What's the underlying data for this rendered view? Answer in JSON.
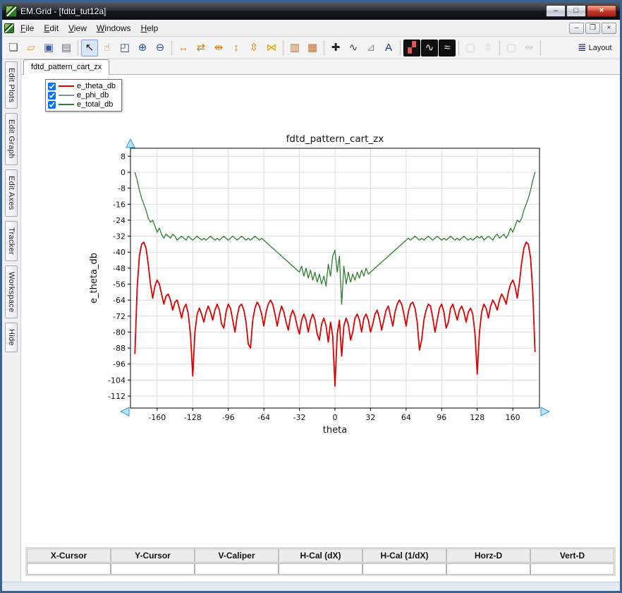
{
  "window": {
    "title": "EM.Grid - [fdtd_tut12a]"
  },
  "titlebar_buttons": [
    {
      "name": "minimize",
      "glyph": "–"
    },
    {
      "name": "maximize",
      "glyph": "□"
    },
    {
      "name": "close",
      "glyph": "×"
    }
  ],
  "menu": {
    "items": [
      "File",
      "Edit",
      "View",
      "Windows",
      "Help"
    ]
  },
  "mdi_buttons": [
    {
      "name": "child-minimize",
      "glyph": "–"
    },
    {
      "name": "child-restore",
      "glyph": "❐"
    },
    {
      "name": "child-close",
      "glyph": "×"
    }
  ],
  "toolbar": {
    "buttons": [
      {
        "name": "new-file",
        "glyph": "❏",
        "color": "#555555"
      },
      {
        "name": "open-folder",
        "glyph": "▱",
        "color": "#d99a2b"
      },
      {
        "name": "save",
        "glyph": "▣",
        "color": "#3a57a8"
      },
      {
        "name": "print",
        "glyph": "▤",
        "color": "#666677"
      },
      {
        "name": "select-cursor",
        "glyph": "↖",
        "color": "#111111",
        "pressed": true,
        "sep": true
      },
      {
        "name": "pan-hand",
        "glyph": "☝",
        "color": "#b9854a"
      },
      {
        "name": "zoom-window",
        "glyph": "◰",
        "color": "#25417a"
      },
      {
        "name": "zoom-in",
        "glyph": "⊕",
        "color": "#1f4fae"
      },
      {
        "name": "zoom-out",
        "glyph": "⊖",
        "color": "#1f4fae"
      },
      {
        "name": "expand-horizontal",
        "glyph": "↔",
        "color": "#e07c00",
        "sep": true
      },
      {
        "name": "shrink-horizontal",
        "glyph": "⇄",
        "color": "#e07c00"
      },
      {
        "name": "full-extent-horizontal",
        "glyph": "⇹",
        "color": "#e07c00"
      },
      {
        "name": "expand-vertical",
        "glyph": "↕",
        "color": "#e07c00"
      },
      {
        "name": "full-extent-vertical",
        "glyph": "⇳",
        "color": "#e07c00"
      },
      {
        "name": "autoscale",
        "glyph": "⋈",
        "color": "#e0a400"
      },
      {
        "name": "data-columns",
        "glyph": "▥",
        "color": "#c26a2a",
        "sep": true
      },
      {
        "name": "data-table",
        "glyph": "▦",
        "color": "#c26a2a"
      },
      {
        "name": "crosshair",
        "glyph": "✚",
        "color": "#222222",
        "sep": true
      },
      {
        "name": "curve-marker",
        "glyph": "∿",
        "color": "#333355"
      },
      {
        "name": "caliper",
        "glyph": "⊿",
        "color": "#8a8a8a"
      },
      {
        "name": "text-annotation",
        "glyph": "A",
        "color": "#1a2e8c"
      },
      {
        "name": "image-style",
        "glyph": "▞",
        "color": "#e05555",
        "dark": true,
        "sep": true
      },
      {
        "name": "waveform-style",
        "glyph": "∿",
        "color": "#f0f0f0",
        "dark": true
      },
      {
        "name": "multi-waveform-style",
        "glyph": "≈",
        "color": "#f0f0f0",
        "dark": true
      },
      {
        "name": "sync-y-toggle",
        "glyph": "▢",
        "color": "#999999",
        "disabled": true,
        "sep": true
      },
      {
        "name": "fit-y",
        "glyph": "⇳",
        "color": "#999999",
        "disabled": true
      },
      {
        "name": "sync-x-toggle",
        "glyph": "▢",
        "color": "#999999",
        "disabled": true,
        "sep": true
      },
      {
        "name": "fit-x",
        "glyph": "⇹",
        "color": "#999999",
        "disabled": true
      },
      {
        "name": "layout",
        "glyph": "≣",
        "color": "#1a2e8c",
        "label": "Layout",
        "sep": true
      }
    ]
  },
  "sidebar": {
    "tabs": [
      "Edit Plots",
      "Edit Graph",
      "Edit Axes",
      "Tracker",
      "Workspace",
      "Hide"
    ]
  },
  "plot_tab": {
    "label": "fdtd_pattern_cart_zx"
  },
  "legend": {
    "items": [
      {
        "label": "e_theta_db",
        "color": "#dd0000",
        "checked": true
      },
      {
        "label": "e_phi_db",
        "color": "#8585c2",
        "checked": true
      },
      {
        "label": "e_total_db",
        "color": "#2e7d32",
        "checked": true
      }
    ]
  },
  "measure_bar": {
    "columns": [
      "X-Cursor",
      "Y-Cursor",
      "V-Caliper",
      "H-Cal (dX)",
      "H-Cal (1/dX)",
      "Horz-D",
      "Vert-D"
    ],
    "values": [
      "",
      "",
      "",
      "",
      "",
      "",
      ""
    ]
  },
  "chart_data": {
    "type": "line",
    "title": "fdtd_pattern_cart_zx",
    "xlabel": "theta",
    "ylabel": "e_theta_db",
    "xlim": [
      -184,
      184
    ],
    "ylim": [
      -118,
      12
    ],
    "xticks": [
      -160,
      -128,
      -96,
      -64,
      -32,
      0,
      32,
      64,
      96,
      128,
      160
    ],
    "yticks": [
      8,
      0,
      -8,
      -16,
      -24,
      -32,
      -40,
      -48,
      -56,
      -64,
      -72,
      -80,
      -88,
      -96,
      -104,
      -112
    ],
    "grid": true,
    "legend_position": "top-left",
    "x_start": -180,
    "x_step": 2,
    "series": [
      {
        "name": "e_theta_db",
        "color": "#e00000",
        "line_width": 1.8,
        "visible": true,
        "values": [
          -91,
          -58,
          -42,
          -36,
          -35,
          -38,
          -46,
          -56,
          -63,
          -57,
          -54,
          -56,
          -61,
          -66,
          -62,
          -61,
          -64,
          -69,
          -65,
          -64,
          -68,
          -73,
          -68,
          -66,
          -71,
          -81,
          -102,
          -80,
          -71,
          -68,
          -71,
          -75,
          -70,
          -67,
          -70,
          -74,
          -69,
          -66,
          -69,
          -76,
          -78,
          -70,
          -66,
          -68,
          -74,
          -80,
          -72,
          -67,
          -66,
          -69,
          -75,
          -86,
          -88,
          -74,
          -68,
          -65,
          -67,
          -71,
          -77,
          -70,
          -66,
          -64,
          -66,
          -71,
          -77,
          -71,
          -67,
          -70,
          -75,
          -79,
          -72,
          -69,
          -72,
          -77,
          -81,
          -74,
          -71,
          -74,
          -80,
          -74,
          -71,
          -74,
          -81,
          -84,
          -76,
          -73,
          -77,
          -85,
          -75,
          -82,
          -107,
          -81,
          -74,
          -92,
          -77,
          -73,
          -76,
          -84,
          -80,
          -73,
          -71,
          -74,
          -80,
          -73,
          -71,
          -74,
          -80,
          -76,
          -71,
          -69,
          -73,
          -79,
          -74,
          -69,
          -67,
          -72,
          -77,
          -70,
          -66,
          -64,
          -66,
          -71,
          -77,
          -70,
          -66,
          -65,
          -68,
          -75,
          -89,
          -84,
          -74,
          -69,
          -66,
          -67,
          -73,
          -80,
          -74,
          -68,
          -66,
          -70,
          -78,
          -75,
          -68,
          -66,
          -70,
          -74,
          -69,
          -67,
          -70,
          -75,
          -70,
          -68,
          -71,
          -81,
          -101,
          -80,
          -70,
          -66,
          -68,
          -73,
          -67,
          -64,
          -66,
          -69,
          -64,
          -61,
          -63,
          -66,
          -60,
          -56,
          -54,
          -57,
          -63,
          -55,
          -45,
          -38,
          -35,
          -36,
          -43,
          -60,
          -90
        ]
      },
      {
        "name": "e_phi_db",
        "color": "#8585c2",
        "line_width": 1.2,
        "visible": false,
        "values": []
      },
      {
        "name": "e_total_db",
        "color": "#2e7d32",
        "line_width": 1.3,
        "visible": true,
        "values": [
          0,
          -4,
          -9,
          -13,
          -16,
          -19,
          -23,
          -25,
          -24,
          -27,
          -30,
          -28,
          -31,
          -33,
          -31,
          -32,
          -33,
          -31,
          -32,
          -34,
          -33,
          -32,
          -33,
          -34,
          -32,
          -33,
          -34,
          -33,
          -32,
          -33,
          -34,
          -33,
          -34,
          -33,
          -32,
          -33,
          -34,
          -33,
          -34,
          -33,
          -32,
          -33,
          -34,
          -33,
          -32,
          -33,
          -34,
          -33,
          -32,
          -33,
          -34,
          -33,
          -34,
          -33,
          -32,
          -33,
          -34,
          -33,
          -34,
          -35,
          -36,
          -37,
          -38,
          -39,
          -40,
          -41,
          -42,
          -43,
          -44,
          -45,
          -46,
          -47,
          -48,
          -49,
          -50,
          -47,
          -52,
          -48,
          -53,
          -49,
          -54,
          -50,
          -55,
          -51,
          -56,
          -52,
          -57,
          -46,
          -52,
          -42,
          -39,
          -50,
          -42,
          -66,
          -47,
          -56,
          -50,
          -55,
          -51,
          -54,
          -50,
          -53,
          -49,
          -52,
          -48,
          -51,
          -50,
          -49,
          -48,
          -47,
          -46,
          -45,
          -44,
          -43,
          -42,
          -41,
          -40,
          -39,
          -38,
          -37,
          -36,
          -35,
          -34,
          -33,
          -34,
          -33,
          -32,
          -33,
          -34,
          -33,
          -34,
          -33,
          -32,
          -33,
          -34,
          -33,
          -32,
          -33,
          -34,
          -33,
          -34,
          -33,
          -32,
          -33,
          -34,
          -33,
          -34,
          -33,
          -32,
          -33,
          -34,
          -33,
          -34,
          -33,
          -32,
          -33,
          -32,
          -34,
          -33,
          -32,
          -33,
          -34,
          -32,
          -31,
          -33,
          -32,
          -31,
          -33,
          -31,
          -28,
          -30,
          -27,
          -24,
          -25,
          -23,
          -19,
          -16,
          -13,
          -9,
          -4,
          0
        ]
      }
    ]
  }
}
